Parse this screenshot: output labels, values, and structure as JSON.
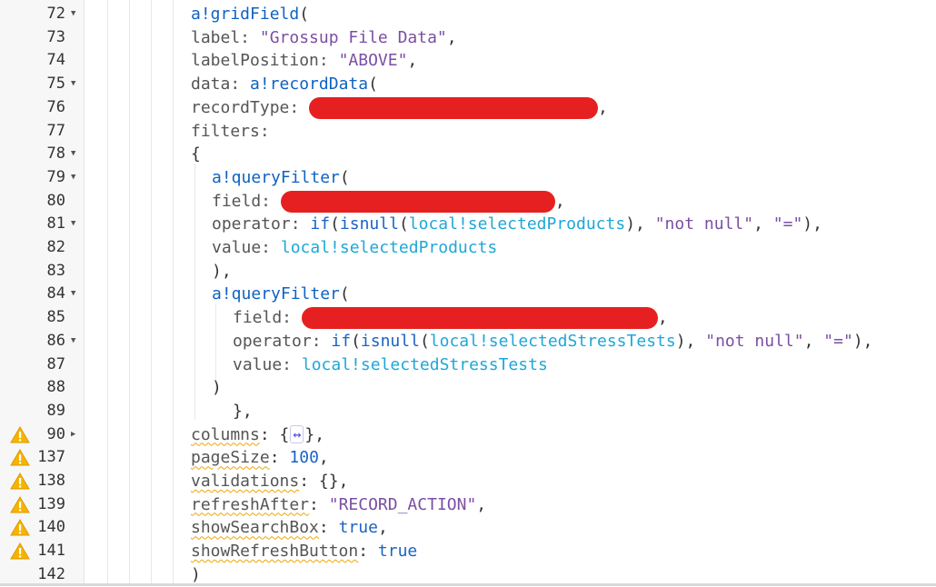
{
  "editor": {
    "lines": [
      {
        "num": "72",
        "fold": "down",
        "warn": false,
        "indent": 210,
        "tokens": [
          {
            "t": "a!gridField",
            "c": "fn"
          },
          {
            "t": "(",
            "c": "p"
          }
        ]
      },
      {
        "num": "73",
        "fold": "",
        "warn": false,
        "indent": 210,
        "tokens": [
          {
            "t": "label: ",
            "c": "lbl"
          },
          {
            "t": "\"Grossup File Data\"",
            "c": "str"
          },
          {
            "t": ",",
            "c": "p"
          }
        ]
      },
      {
        "num": "74",
        "fold": "",
        "warn": false,
        "indent": 210,
        "tokens": [
          {
            "t": "labelPosition: ",
            "c": "lbl"
          },
          {
            "t": "\"ABOVE\"",
            "c": "str"
          },
          {
            "t": ",",
            "c": "p"
          }
        ]
      },
      {
        "num": "75",
        "fold": "down",
        "warn": false,
        "indent": 210,
        "tokens": [
          {
            "t": "data: ",
            "c": "lbl"
          },
          {
            "t": "a!recordData",
            "c": "fn"
          },
          {
            "t": "(",
            "c": "p"
          }
        ]
      },
      {
        "num": "76",
        "fold": "",
        "warn": false,
        "indent": 210,
        "tokens": [
          {
            "t": "recordType: ",
            "c": "lbl"
          },
          {
            "t": "",
            "c": "redact",
            "w": 318
          },
          {
            "t": ",",
            "c": "p"
          }
        ]
      },
      {
        "num": "77",
        "fold": "",
        "warn": false,
        "indent": 210,
        "tokens": [
          {
            "t": "filters:",
            "c": "lbl"
          }
        ]
      },
      {
        "num": "78",
        "fold": "down",
        "warn": false,
        "indent": 210,
        "tokens": [
          {
            "t": "{",
            "c": "p"
          }
        ]
      },
      {
        "num": "79",
        "fold": "down",
        "warn": false,
        "indent": 233,
        "tokens": [
          {
            "t": "a!queryFilter",
            "c": "fn"
          },
          {
            "t": "(",
            "c": "p"
          }
        ]
      },
      {
        "num": "80",
        "fold": "",
        "warn": false,
        "indent": 233,
        "tokens": [
          {
            "t": "field: ",
            "c": "lbl"
          },
          {
            "t": "",
            "c": "redact",
            "w": 302
          },
          {
            "t": ",",
            "c": "p"
          }
        ]
      },
      {
        "num": "81",
        "fold": "down",
        "warn": false,
        "indent": 233,
        "tokens": [
          {
            "t": "operator: ",
            "c": "lbl"
          },
          {
            "t": "if",
            "c": "kw"
          },
          {
            "t": "(",
            "c": "p"
          },
          {
            "t": "isnull",
            "c": "kw"
          },
          {
            "t": "(",
            "c": "p"
          },
          {
            "t": "local!selectedProducts",
            "c": "var"
          },
          {
            "t": "), ",
            "c": "p"
          },
          {
            "t": "\"not null\"",
            "c": "str"
          },
          {
            "t": ", ",
            "c": "p"
          },
          {
            "t": "\"=\"",
            "c": "str"
          },
          {
            "t": "),",
            "c": "p"
          }
        ]
      },
      {
        "num": "82",
        "fold": "",
        "warn": false,
        "indent": 233,
        "tokens": [
          {
            "t": "value: ",
            "c": "lbl"
          },
          {
            "t": "local!selectedProducts",
            "c": "var"
          }
        ]
      },
      {
        "num": "83",
        "fold": "",
        "warn": false,
        "indent": 233,
        "tokens": [
          {
            "t": "),",
            "c": "p"
          }
        ]
      },
      {
        "num": "84",
        "fold": "down",
        "warn": false,
        "indent": 233,
        "tokens": [
          {
            "t": "a!queryFilter",
            "c": "fn"
          },
          {
            "t": "(",
            "c": "p"
          }
        ]
      },
      {
        "num": "85",
        "fold": "",
        "warn": false,
        "indent": 256,
        "tokens": [
          {
            "t": "field: ",
            "c": "lbl"
          },
          {
            "t": "",
            "c": "redact",
            "w": 392
          },
          {
            "t": ",",
            "c": "p"
          }
        ]
      },
      {
        "num": "86",
        "fold": "down",
        "warn": false,
        "indent": 256,
        "tokens": [
          {
            "t": "operator: ",
            "c": "lbl"
          },
          {
            "t": "if",
            "c": "kw"
          },
          {
            "t": "(",
            "c": "p"
          },
          {
            "t": "isnull",
            "c": "kw"
          },
          {
            "t": "(",
            "c": "p"
          },
          {
            "t": "local!selectedStressTests",
            "c": "var"
          },
          {
            "t": "), ",
            "c": "p"
          },
          {
            "t": "\"not null\"",
            "c": "str"
          },
          {
            "t": ", ",
            "c": "p"
          },
          {
            "t": "\"=\"",
            "c": "str"
          },
          {
            "t": "),",
            "c": "p"
          }
        ]
      },
      {
        "num": "87",
        "fold": "",
        "warn": false,
        "indent": 256,
        "tokens": [
          {
            "t": "value: ",
            "c": "lbl"
          },
          {
            "t": "local!selectedStressTests",
            "c": "var"
          }
        ]
      },
      {
        "num": "88",
        "fold": "",
        "warn": false,
        "indent": 233,
        "tokens": [
          {
            "t": ")",
            "c": "p"
          }
        ]
      },
      {
        "num": "89",
        "fold": "",
        "warn": false,
        "indent": 256,
        "tokens": [
          {
            "t": "},",
            "c": "p"
          }
        ]
      },
      {
        "num": "90",
        "fold": "right",
        "warn": true,
        "indent": 210,
        "tokens": [
          {
            "t": "columns",
            "c": "lbl",
            "sq": true
          },
          {
            "t": ": {",
            "c": "p"
          },
          {
            "t": "↔",
            "c": "collapsed"
          },
          {
            "t": "},",
            "c": "p"
          }
        ]
      },
      {
        "num": "137",
        "fold": "",
        "warn": true,
        "indent": 210,
        "tokens": [
          {
            "t": "pageSize",
            "c": "lbl",
            "sq": true
          },
          {
            "t": ": ",
            "c": "p"
          },
          {
            "t": "100",
            "c": "num"
          },
          {
            "t": ",",
            "c": "p"
          }
        ]
      },
      {
        "num": "138",
        "fold": "",
        "warn": true,
        "indent": 210,
        "tokens": [
          {
            "t": "validations",
            "c": "lbl",
            "sq": true
          },
          {
            "t": ": {},",
            "c": "p"
          }
        ]
      },
      {
        "num": "139",
        "fold": "",
        "warn": true,
        "indent": 210,
        "tokens": [
          {
            "t": "refreshAfter",
            "c": "lbl",
            "sq": true
          },
          {
            "t": ": ",
            "c": "p"
          },
          {
            "t": "\"RECORD_ACTION\"",
            "c": "str"
          },
          {
            "t": ",",
            "c": "p"
          }
        ]
      },
      {
        "num": "140",
        "fold": "",
        "warn": true,
        "indent": 210,
        "tokens": [
          {
            "t": "showSearchBox",
            "c": "lbl",
            "sq": true
          },
          {
            "t": ": ",
            "c": "p"
          },
          {
            "t": "true",
            "c": "kw"
          },
          {
            "t": ",",
            "c": "p"
          }
        ]
      },
      {
        "num": "141",
        "fold": "",
        "warn": true,
        "indent": 210,
        "tokens": [
          {
            "t": "showRefreshButton",
            "c": "lbl",
            "sq": true
          },
          {
            "t": ": ",
            "c": "p"
          },
          {
            "t": "true",
            "c": "kw"
          }
        ]
      },
      {
        "num": "142",
        "fold": "",
        "warn": false,
        "indent": 210,
        "tokens": [
          {
            "t": ")",
            "c": "p"
          }
        ]
      }
    ]
  }
}
